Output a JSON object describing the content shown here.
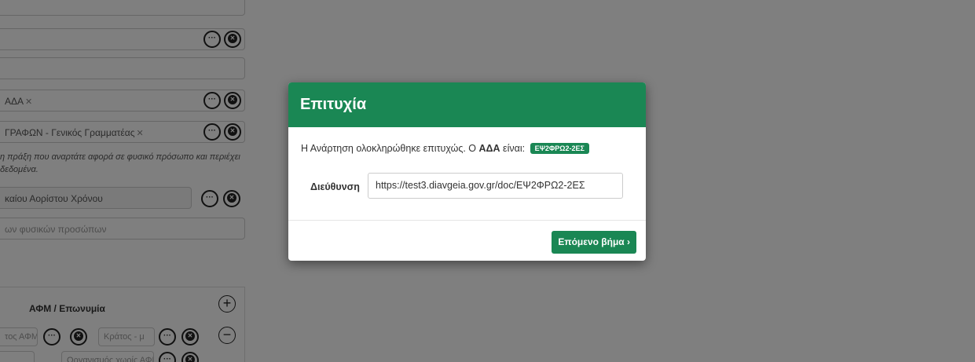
{
  "background": {
    "fields": [
      {
        "text": ""
      },
      {
        "text": ""
      },
      {
        "text": "ΑΔΑ",
        "remove": "✕"
      },
      {
        "text": "ΓΡΑΦΩΝ - Γενικός Γραμματέας",
        "remove": "✕"
      },
      {
        "text": "καίου Αορίστου Χρόνου"
      },
      {
        "text": "ων φυσικών προσώπων"
      }
    ],
    "note_line1": "η πράξη που αναρτάτε αφορά σε φυσικό πρόσωπο και περιέχει",
    "note_line2": "δεδομένα.",
    "table": {
      "header": "ΑΦΜ / Επωνυμία",
      "row1_input1": "τος ΑΦΜ",
      "row1_input2": "Κράτος - μ",
      "row2_input2": "Οργανισμός χωρίς ΑΦΜ"
    }
  },
  "modal": {
    "title": "Επιτυχία",
    "message_prefix": "Η Ανάρτηση ολοκληρώθηκε επιτυχώς. Ο ",
    "message_bold": "ΑΔΑ",
    "message_suffix": " είναι: ",
    "ada_badge": "ΕΨ2ΦΡΩ2-2ΕΣ",
    "url_label": "Διεύθυνση",
    "url_value": "https://test3.diavgeia.gov.gr/doc/ΕΨ2ΦΡΩ2-2ΕΣ",
    "next_button": "Επόμενο βήμα ›"
  },
  "colors": {
    "success": "#1a8754",
    "overlay": "rgba(0,0,0,0.5)"
  }
}
